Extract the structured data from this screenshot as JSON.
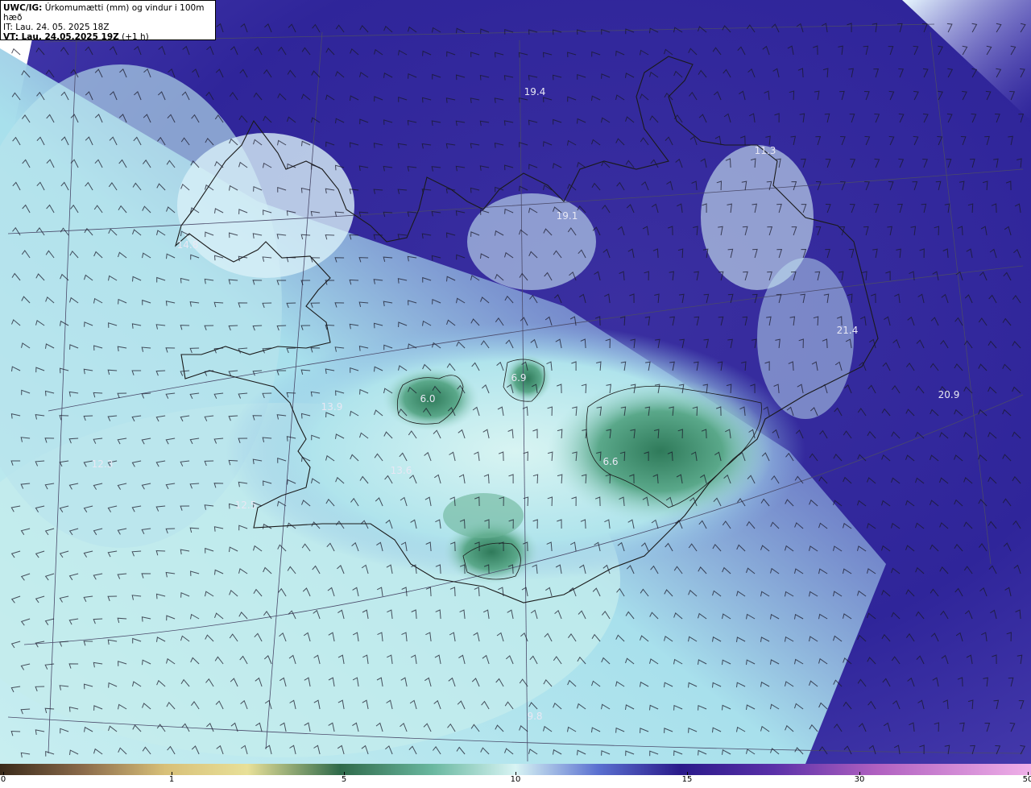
{
  "header": {
    "title_prefix": "UWC/IG:",
    "title_rest": " Úrkomumætti (mm) og vindur i 100m hæð",
    "it_line": "IT: Lau. 24. 05. 2025 18Z",
    "vt_prefix": "VT: Lau. 24.05.2025 19Z",
    "vt_suffix": " (+1 h)"
  },
  "colors": {
    "ocean_deep": "#2a1f8a",
    "ocean_mid": "#3d34a8",
    "light_cyan": "#c8f0f0",
    "teal_green": "#3a8a6a",
    "coast": "#1a1a1a"
  },
  "map_labels": [
    {
      "text": "19.4"
    },
    {
      "text": "11.3"
    },
    {
      "text": "19.1"
    },
    {
      "text": "14.8"
    },
    {
      "text": "21.4"
    },
    {
      "text": "20.9"
    },
    {
      "text": "13.9"
    },
    {
      "text": "6.0"
    },
    {
      "text": "6.9"
    },
    {
      "text": "6.6"
    },
    {
      "text": "13.6"
    },
    {
      "text": "12.3"
    },
    {
      "text": "12.5"
    },
    {
      "text": "9.8"
    }
  ],
  "colorbar": {
    "ticks": [
      "0",
      "1",
      "5",
      "10",
      "15",
      "30",
      "50"
    ]
  }
}
